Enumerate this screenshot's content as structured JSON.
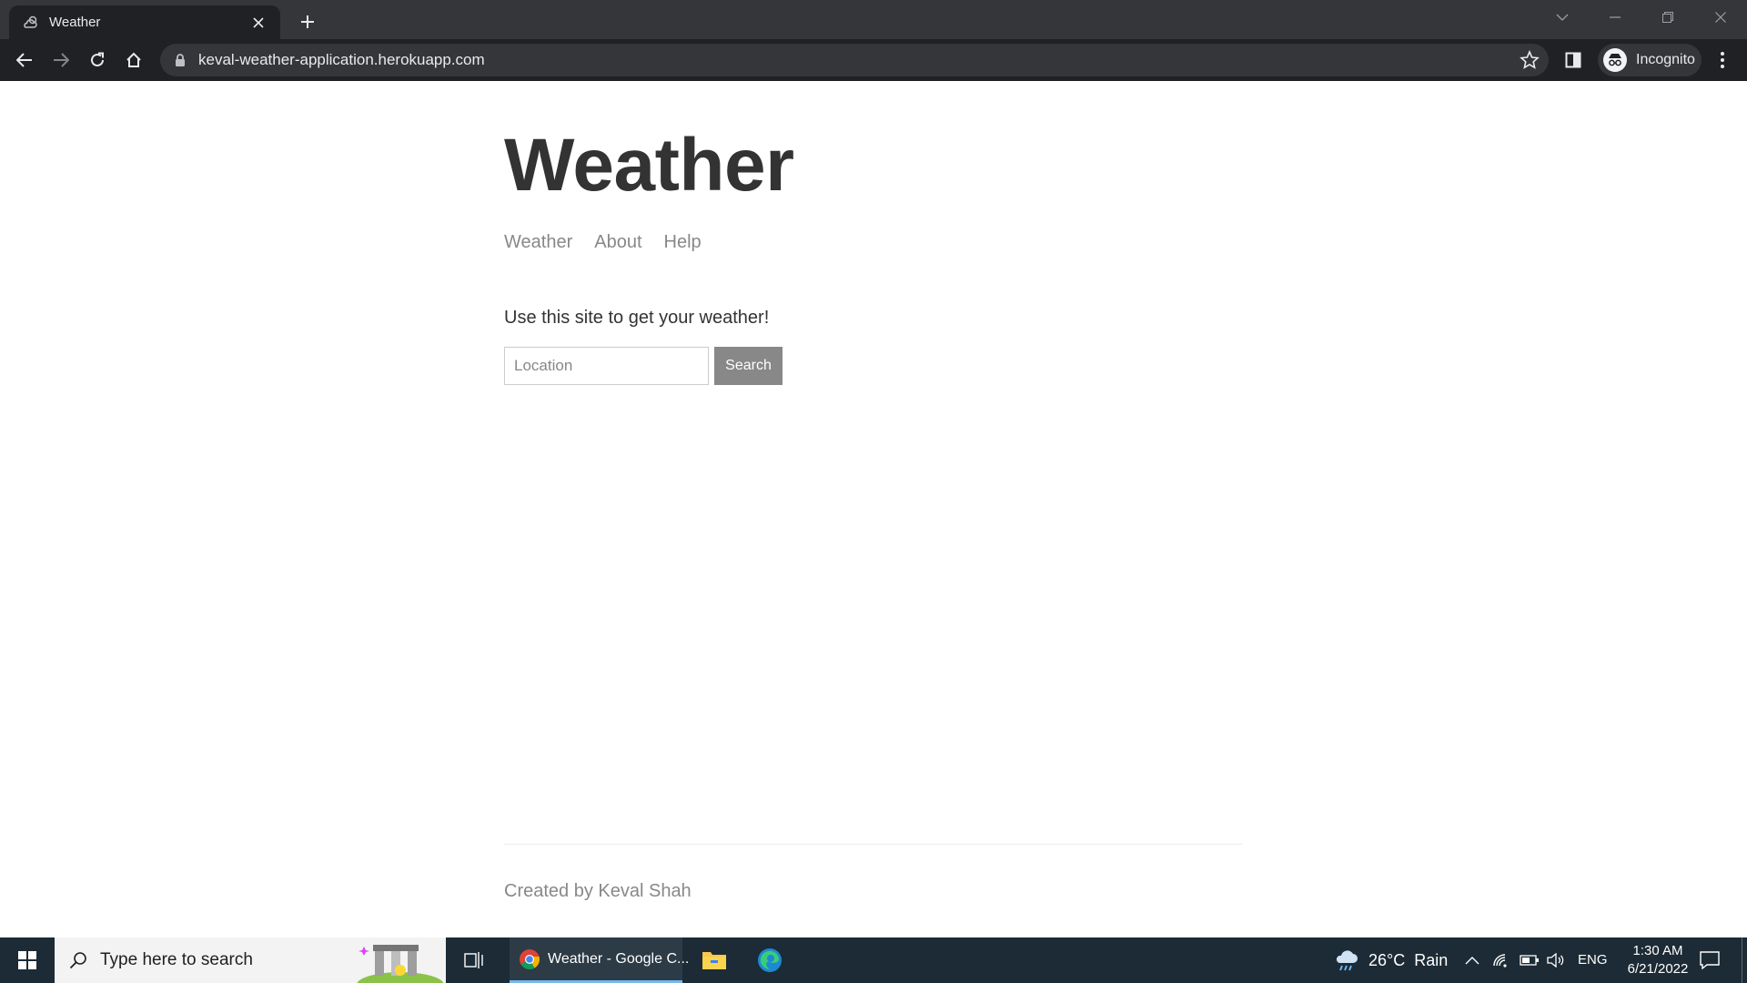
{
  "browser": {
    "tab_title": "Weather",
    "url": "keval-weather-application.herokuapp.com",
    "profile_label": "Incognito"
  },
  "page": {
    "site_title": "Weather",
    "nav": [
      "Weather",
      "About",
      "Help"
    ],
    "intro": "Use this site to get your weather!",
    "search": {
      "placeholder": "Location",
      "button_label": "Search"
    },
    "footer": "Created by Keval Shah"
  },
  "taskbar": {
    "search_placeholder": "Type here to search",
    "active_app_label": "Weather - Google C...",
    "weather_text": "26°C  Rain",
    "language": "ENG",
    "time": "1:30 AM",
    "date": "6/21/2022"
  }
}
